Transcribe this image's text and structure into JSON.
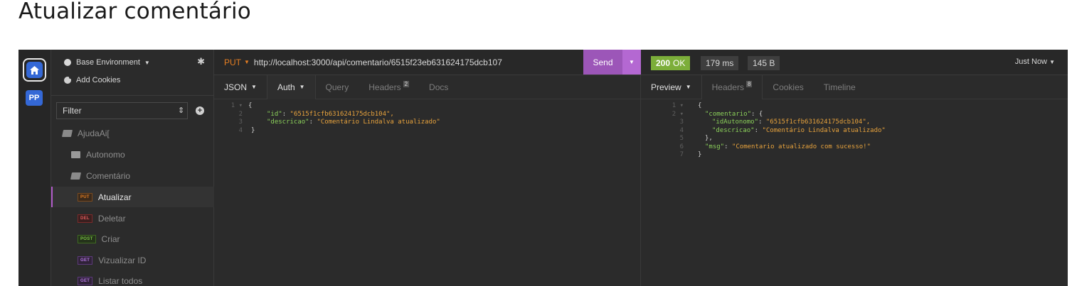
{
  "doc_title": "Atualizar comentário",
  "rail": {
    "workspace_initials": "PP"
  },
  "sidebar": {
    "environment": "Base Environment",
    "add_cookies": "Add Cookies",
    "filter_placeholder": "Filter",
    "tree": [
      {
        "type": "folder-open",
        "label": "AjudaAi["
      },
      {
        "type": "folder",
        "label": "Autonomo"
      },
      {
        "type": "folder-open",
        "label": "Comentário"
      },
      {
        "type": "request",
        "method": "PUT",
        "label": "Atualizar",
        "active": true
      },
      {
        "type": "request",
        "method": "DEL",
        "label": "Deletar"
      },
      {
        "type": "request",
        "method": "POST",
        "label": "Criar"
      },
      {
        "type": "request",
        "method": "GET",
        "label": "Vizualizar ID"
      },
      {
        "type": "request",
        "method": "GET",
        "label": "Listar todos"
      }
    ]
  },
  "request": {
    "method": "PUT",
    "url": "http://localhost:3000/api/comentario/6515f23eb631624175dcb107",
    "send_label": "Send",
    "tabs": {
      "body": "JSON",
      "auth": "Auth",
      "query": "Query",
      "headers": "Headers",
      "headers_count": "2",
      "docs": "Docs"
    },
    "body_lines": [
      {
        "n": "1",
        "text": "{"
      },
      {
        "n": "2",
        "key": "\"id\"",
        "value": "\"6515f1cfb631624175dcb104\","
      },
      {
        "n": "3",
        "key": "\"descricao\"",
        "value": "\"Comentário Lindalva atualizado\""
      },
      {
        "n": "4",
        "text": "}"
      }
    ]
  },
  "response": {
    "status_code": "200",
    "status_text": "OK",
    "time": "179 ms",
    "size": "145 B",
    "timestamp": "Just Now",
    "tabs": {
      "preview": "Preview",
      "headers": "Headers",
      "headers_count": "8",
      "cookies": "Cookies",
      "timeline": "Timeline"
    },
    "lines": [
      {
        "n": "1",
        "text": "{"
      },
      {
        "n": "2",
        "key": "\"comentario\"",
        "tail": ": {"
      },
      {
        "n": "3",
        "key": "\"idAutonomo\"",
        "value": "\"6515f1cfb631624175dcb104\","
      },
      {
        "n": "4",
        "key": "\"descricao\"",
        "value": "\"Comentário Lindalva atualizado\""
      },
      {
        "n": "5",
        "text": "},"
      },
      {
        "n": "6",
        "key": "\"msg\"",
        "value": "\"Comentario atualizado com sucesso!\""
      },
      {
        "n": "7",
        "text": "}"
      }
    ]
  },
  "colors": {
    "accent_purple": "#9c56b8",
    "status_ok": "#7cae3a",
    "put_orange": "#e67e22",
    "workspace_blue": "#3468d6"
  }
}
